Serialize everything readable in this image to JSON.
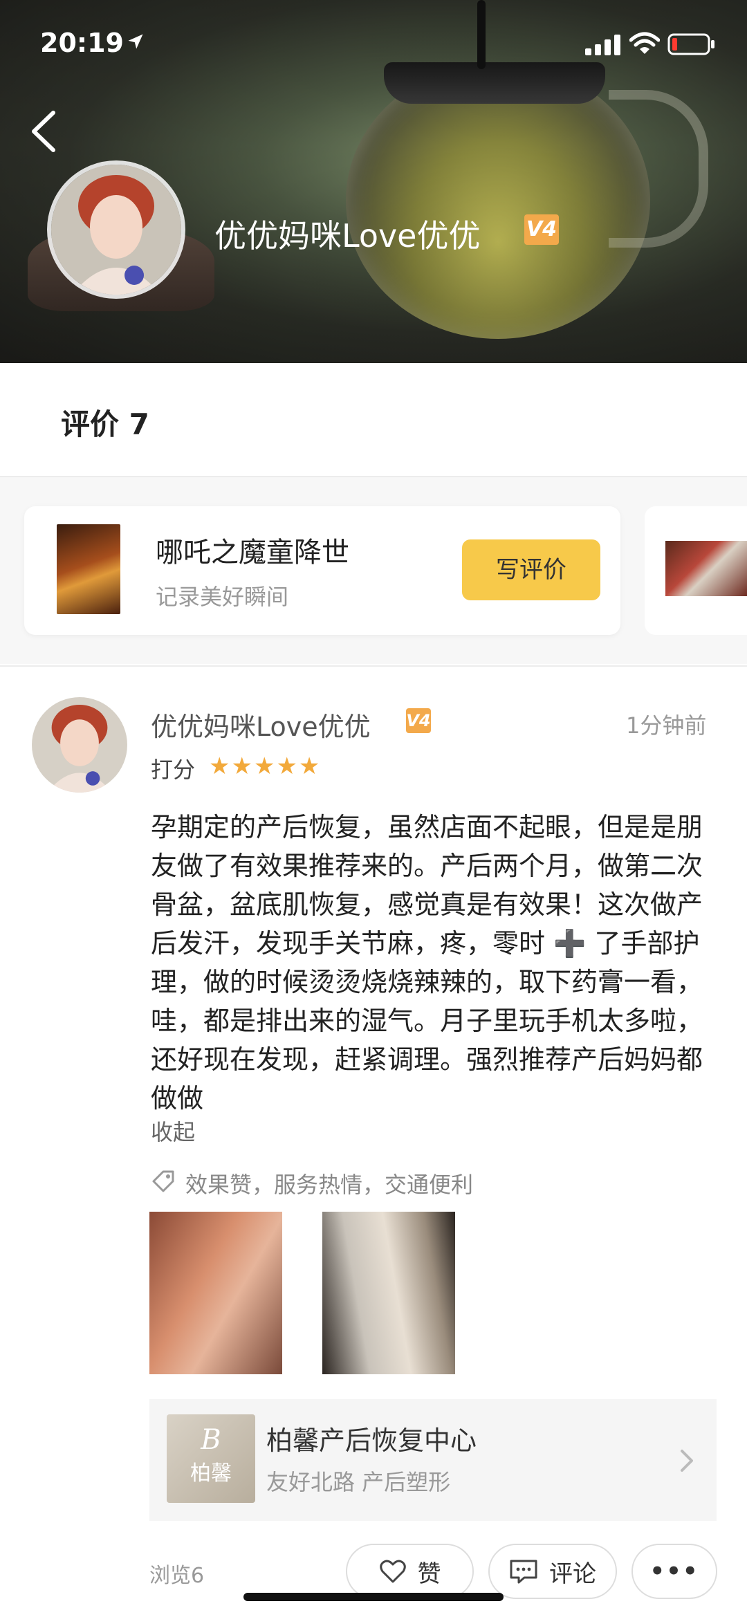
{
  "status_bar": {
    "time": "20:19"
  },
  "header": {
    "username": "优优妈咪Love优优",
    "level_badge": "V4"
  },
  "reviews_section": {
    "title": "评价 7"
  },
  "movie_card": {
    "title": "哪吒之魔童降世",
    "subtitle": "记录美好瞬间",
    "button_label": "写评价"
  },
  "review": {
    "username": "优优妈咪Love优优",
    "level_badge": "V4",
    "time": "1分钟前",
    "rating_label": "打分",
    "rating": 5,
    "stars": "★★★★★",
    "text": "孕期定的产后恢复，虽然店面不起眼，但是是朋友做了有效果推荐来的。产后两个月，做第二次骨盆，盆底肌恢复，感觉真是有效果！这次做产后发汗，发现手关节麻，疼，零时 ➕ 了手部护理，做的时候烫烫烧烧辣辣的，取下药膏一看，哇，都是排出来的湿气。月子里玩手机太多啦，还好现在发现，赶紧调理。强烈推荐产后妈妈都做做",
    "collapse_label": "收起",
    "tags": "效果赞，服务热情，交通便利",
    "shop": {
      "name": "柏馨产后恢复中心",
      "subtitle": "友好北路 产后塑形",
      "logo_text": "柏馨"
    },
    "views": "浏览6",
    "like_label": "赞",
    "comment_label": "评论",
    "more_label": "•••"
  },
  "colors": {
    "accent_yellow": "#f7c94a",
    "star": "#f2a93b",
    "badge": "#f3a94b"
  }
}
